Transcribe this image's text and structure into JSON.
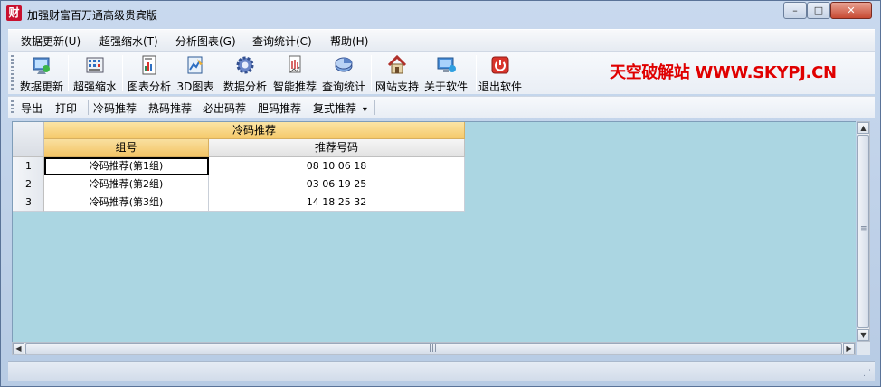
{
  "window": {
    "app_icon_text": "财",
    "title": "加强财富百万通高级贵宾版",
    "minimize_glyph": "–",
    "maximize_glyph": "□",
    "close_glyph": "✕"
  },
  "menu": [
    {
      "label": "数据更新(U)"
    },
    {
      "label": "超强缩水(T)"
    },
    {
      "label": "分析图表(G)"
    },
    {
      "label": "查询统计(C)"
    },
    {
      "label": "帮助(H)"
    }
  ],
  "toolbar": {
    "items": [
      {
        "label": "数据更新",
        "icon": "data-update-icon"
      },
      {
        "label": "超强缩水",
        "icon": "shrink-icon"
      },
      {
        "label": "图表分析",
        "icon": "chart-analysis-icon"
      },
      {
        "label": "3D图表",
        "icon": "chart-3d-icon"
      },
      {
        "label": "数据分析",
        "icon": "gear-icon"
      },
      {
        "label": "智能推荐",
        "icon": "smart-recommend-icon"
      },
      {
        "label": "查询统计",
        "icon": "query-icon"
      },
      {
        "label": "网站支持",
        "icon": "home-icon"
      },
      {
        "label": "关于软件",
        "icon": "about-icon"
      },
      {
        "label": "退出软件",
        "icon": "power-icon"
      }
    ],
    "watermark": "天空破解站 WWW.SKYPJ.CN"
  },
  "subbar": {
    "items": [
      {
        "label": "导出"
      },
      {
        "label": "打印"
      },
      {
        "label": "冷码推荐"
      },
      {
        "label": "热码推荐"
      },
      {
        "label": "必出码荐"
      },
      {
        "label": "胆码推荐"
      },
      {
        "label": "复式推荐"
      }
    ],
    "dropdown_glyph": "▾"
  },
  "grid": {
    "band_header": "冷码推荐",
    "columns": [
      "组号",
      "推荐号码"
    ],
    "rows": [
      {
        "num": "1",
        "group": "冷码推荐(第1组)",
        "numbers": "08 10 06 18"
      },
      {
        "num": "2",
        "group": "冷码推荐(第2组)",
        "numbers": "03 06 19 25"
      },
      {
        "num": "3",
        "group": "冷码推荐(第3组)",
        "numbers": "14 18 25 32"
      }
    ]
  },
  "scroll": {
    "up": "▲",
    "down": "▼",
    "left": "◀",
    "right": "▶",
    "grip_v": "≡",
    "grip_h": "|||"
  },
  "status": {
    "grip": "⋰"
  }
}
